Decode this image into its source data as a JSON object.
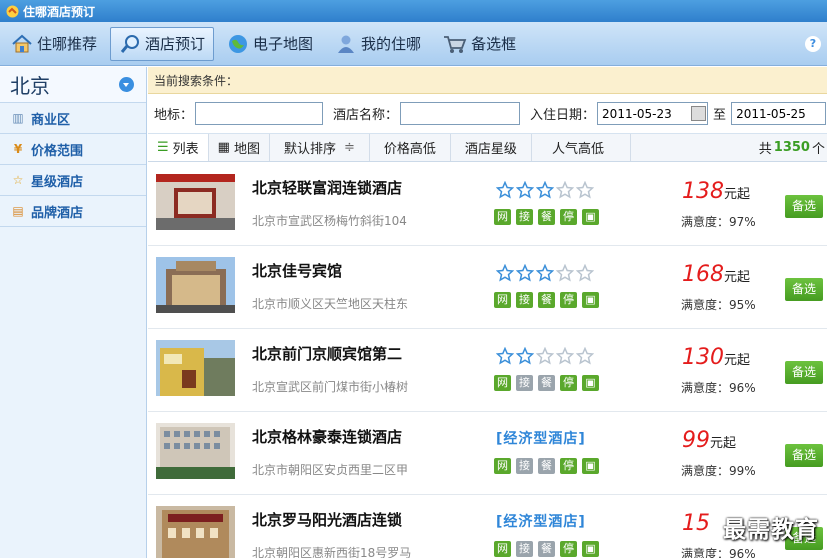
{
  "window": {
    "title": "住哪酒店预订"
  },
  "toolbar": {
    "items": [
      {
        "label": "住哪推荐"
      },
      {
        "label": "酒店预订"
      },
      {
        "label": "电子地图"
      },
      {
        "label": "我的住哪"
      },
      {
        "label": "备选框"
      }
    ],
    "help": "?"
  },
  "sidebar": {
    "city": "北京",
    "items": [
      {
        "label": "商业区"
      },
      {
        "label": "价格范围"
      },
      {
        "label": "星级酒店"
      },
      {
        "label": "品牌酒店"
      }
    ]
  },
  "search": {
    "conditions_label": "当前搜索条件：",
    "landmark_label": "地标：",
    "landmark_value": "",
    "hotel_name_label": "酒店名称：",
    "hotel_name_value": "",
    "checkin_label": "入住日期：",
    "checkin_value": "2011-05-23",
    "to_label": "至",
    "checkout_value": "2011-05-25"
  },
  "sortbar": {
    "list_tab": "列表",
    "map_tab": "地图",
    "default_sort": "默认排序",
    "sort_arrow": "≑",
    "price": "价格高低",
    "stars": "酒店星级",
    "popularity": "人气高低",
    "total_prefix": "共",
    "total_count": "1350",
    "total_suffix": "个"
  },
  "hotels": [
    {
      "name": "北京轻联富润连锁酒店",
      "address": "北京市宣武区杨梅竹斜街104",
      "stars": 3,
      "type": "",
      "price": "138",
      "price_unit": "元起",
      "satisfaction": "满意度：97%",
      "facilities": [
        true,
        true,
        true,
        true,
        true
      ],
      "pick": "备选"
    },
    {
      "name": "北京佳号宾馆",
      "address": "北京市顺义区天竺地区天柱东",
      "stars": 3,
      "type": "",
      "price": "168",
      "price_unit": "元起",
      "satisfaction": "满意度：95%",
      "facilities": [
        true,
        true,
        true,
        true,
        true
      ],
      "pick": "备选"
    },
    {
      "name": "北京前门京顺宾馆第二",
      "address": "北京宣武区前门煤市街小椿树",
      "stars": 2,
      "type": "",
      "price": "130",
      "price_unit": "元起",
      "satisfaction": "满意度：96%",
      "facilities": [
        true,
        false,
        false,
        true,
        true
      ],
      "pick": "备选"
    },
    {
      "name": "北京格林豪泰连锁酒店",
      "address": "北京市朝阳区安贞西里二区甲",
      "stars": 0,
      "type": "[经济型酒店]",
      "price": "99",
      "price_unit": "元起",
      "satisfaction": "满意度：99%",
      "facilities": [
        true,
        false,
        false,
        true,
        true
      ],
      "pick": "备选"
    },
    {
      "name": "北京罗马阳光酒店连锁",
      "address": "北京朝阳区惠新西街18号罗马",
      "stars": 0,
      "type": "[经济型酒店]",
      "price": "15",
      "price_unit": "",
      "satisfaction": "满意度：96%",
      "facilities": [
        true,
        false,
        false,
        true,
        true
      ],
      "pick": "备选"
    }
  ],
  "facility_labels": [
    "网",
    "接",
    "餐",
    "停",
    "▣"
  ],
  "watermark": "最需教育",
  "colors": {
    "accent": "#2f7fcc",
    "price": "#e41c1c",
    "green": "#469c21",
    "count": "#3a9d23"
  }
}
